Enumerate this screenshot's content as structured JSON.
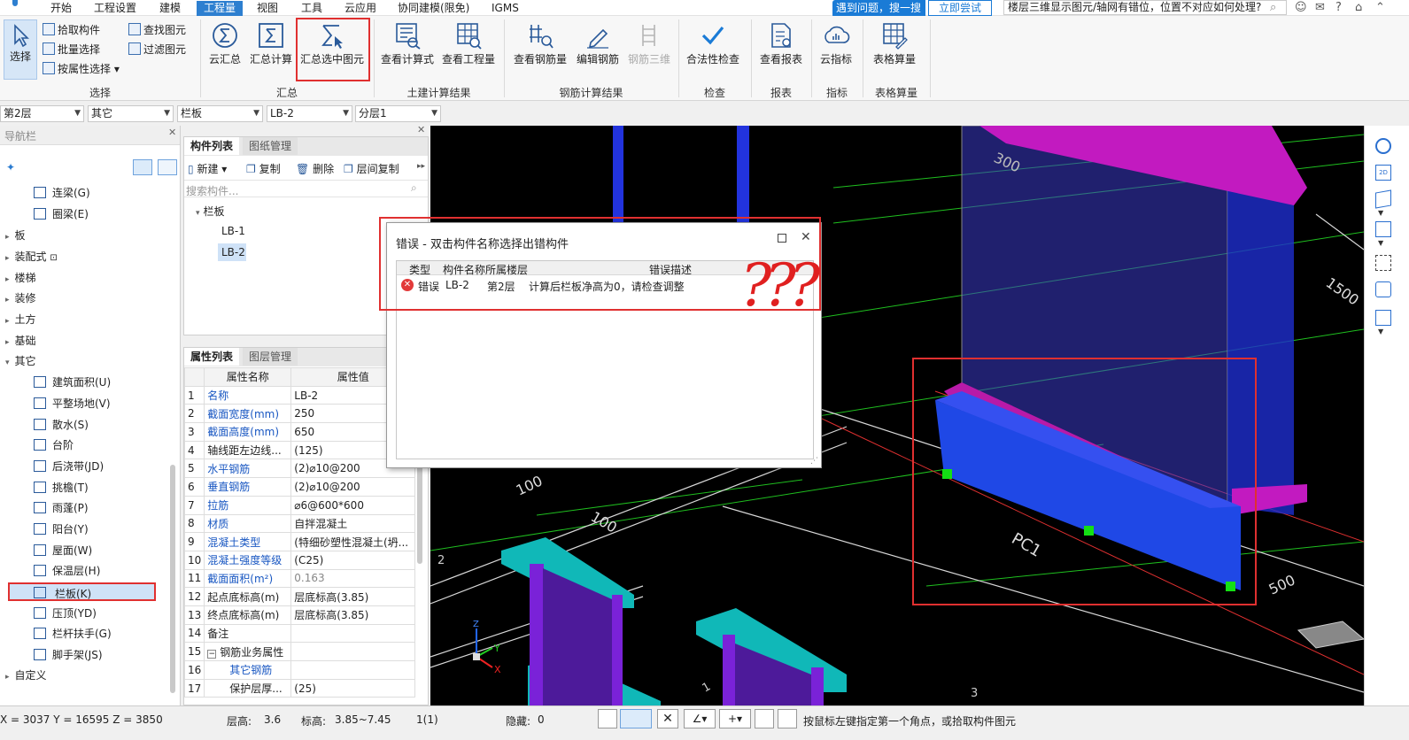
{
  "menu": {
    "items": [
      "开始",
      "工程设置",
      "建模",
      "工程量",
      "视图",
      "工具",
      "云应用",
      "协同建模(限免)",
      "IGMS"
    ],
    "active": "工程量",
    "promo": "遇到问题，搜一搜",
    "try_button": "立即尝试",
    "search_text": "楼层三维显示图元/轴网有错位，位置不对应如何处理?"
  },
  "ribbon": {
    "select_group": {
      "label": "选择",
      "select_button": "选择",
      "pick": "拾取构件",
      "batch": "批量选择",
      "by_attr": "按属性选择",
      "find": "查找图元",
      "filter": "过滤图元"
    },
    "summary_group": {
      "label": "汇总",
      "cloud_sum": "云汇总",
      "sum_calc": "汇总计算",
      "sum_selected": "汇总选中图元"
    },
    "civil_group": {
      "label": "土建计算结果",
      "view_formula": "查看计算式",
      "view_qty": "查看工程量"
    },
    "rebar_group": {
      "label": "钢筋计算结果",
      "view_rebar": "查看钢筋量",
      "edit_rebar": "编辑钢筋",
      "rebar_3d": "钢筋三维"
    },
    "check_group": {
      "label": "检查",
      "legality": "合法性检查"
    },
    "report_group": {
      "label": "报表",
      "view_report": "查看报表"
    },
    "index_group": {
      "label": "指标",
      "cloud_index": "云指标"
    },
    "table_group": {
      "label": "表格算量",
      "table_qty": "表格算量"
    }
  },
  "selectors": {
    "floor": "第2层",
    "category": "其它",
    "type": "栏板",
    "component": "LB-2",
    "layer": "分层1"
  },
  "nav": {
    "title": "导航栏",
    "items": [
      "连梁(G)",
      "圈梁(E)",
      "板",
      "装配式",
      "楼梯",
      "装修",
      "土方",
      "基础",
      "其它",
      "建筑面积(U)",
      "平整场地(V)",
      "散水(S)",
      "台阶",
      "后浇带(JD)",
      "挑檐(T)",
      "雨蓬(P)",
      "阳台(Y)",
      "屋面(W)",
      "保温层(H)",
      "栏板(K)",
      "压顶(YD)",
      "栏杆扶手(G)",
      "脚手架(JS)",
      "自定义"
    ]
  },
  "component_list": {
    "tab_active": "构件列表",
    "tab_other": "图纸管理",
    "new": "新建",
    "copy": "复制",
    "delete": "删除",
    "floor_copy": "层间复制",
    "search_placeholder": "搜索构件...",
    "tree_root": "栏板",
    "items": [
      "LB-1",
      "LB-2"
    ],
    "selected": "LB-2"
  },
  "property_list": {
    "tab_active": "属性列表",
    "tab_other": "图层管理",
    "col_name": "属性名称",
    "col_value": "属性值",
    "rows": [
      {
        "n": "1",
        "name": "名称",
        "value": "LB-2"
      },
      {
        "n": "2",
        "name": "截面宽度(mm)",
        "value": "250"
      },
      {
        "n": "3",
        "name": "截面高度(mm)",
        "value": "650"
      },
      {
        "n": "4",
        "name": "轴线距左边线...",
        "value": "(125)"
      },
      {
        "n": "5",
        "name": "水平钢筋",
        "value": "(2)⌀10@200"
      },
      {
        "n": "6",
        "name": "垂直钢筋",
        "value": "(2)⌀10@200"
      },
      {
        "n": "7",
        "name": "拉筋",
        "value": "⌀6@600*600"
      },
      {
        "n": "8",
        "name": "材质",
        "value": "自拌混凝土"
      },
      {
        "n": "9",
        "name": "混凝土类型",
        "value": "(特细砂塑性混凝土(坍..."
      },
      {
        "n": "10",
        "name": "混凝土强度等级",
        "value": "(C25)"
      },
      {
        "n": "11",
        "name": "截面面积(m²)",
        "value": "0.163"
      },
      {
        "n": "12",
        "name": "起点底标高(m)",
        "value": "层底标高(3.85)"
      },
      {
        "n": "13",
        "name": "终点底标高(m)",
        "value": "层底标高(3.85)"
      },
      {
        "n": "14",
        "name": "备注",
        "value": ""
      },
      {
        "n": "15",
        "name": "钢筋业务属性",
        "value": ""
      },
      {
        "n": "16",
        "name": "其它钢筋",
        "value": ""
      },
      {
        "n": "17",
        "name": "保护层厚...",
        "value": "(25)"
      }
    ]
  },
  "dialog": {
    "title": "错误 - 双击构件名称选择出错构件",
    "col_type": "类型",
    "col_name": "构件名称",
    "col_floor": "所属楼层",
    "col_desc": "错误描述",
    "row": {
      "type": "错误",
      "name": "LB-2",
      "floor": "第2层",
      "desc": "计算后栏板净高为0，请检查调整"
    },
    "annotation": "???"
  },
  "viewport_labels": {
    "pc1": "PC1",
    "dim_300": "300",
    "dim_1500": "1500",
    "dim_100a": "100",
    "dim_100b": "100",
    "dim_500": "500",
    "axis_1": "1",
    "axis_2": "2",
    "axis_3": "3",
    "axis_x": "X",
    "axis_y": "Y",
    "axis_z": "Z"
  },
  "status": {
    "coords": "X = 3037 Y = 16595 Z = 3850",
    "floor_height_label": "层高:",
    "floor_height": "3.6",
    "elev_label": "标高:",
    "elev": "3.85~7.45",
    "count": "1(1)",
    "hidden_label": "隐藏:",
    "hidden": "0",
    "hint": "按鼠标左键指定第一个角点，或拾取构件图元"
  },
  "colors": {
    "accent": "#2d7fd0",
    "highlight_red": "#e03030",
    "viewport_bg": "#000000"
  }
}
